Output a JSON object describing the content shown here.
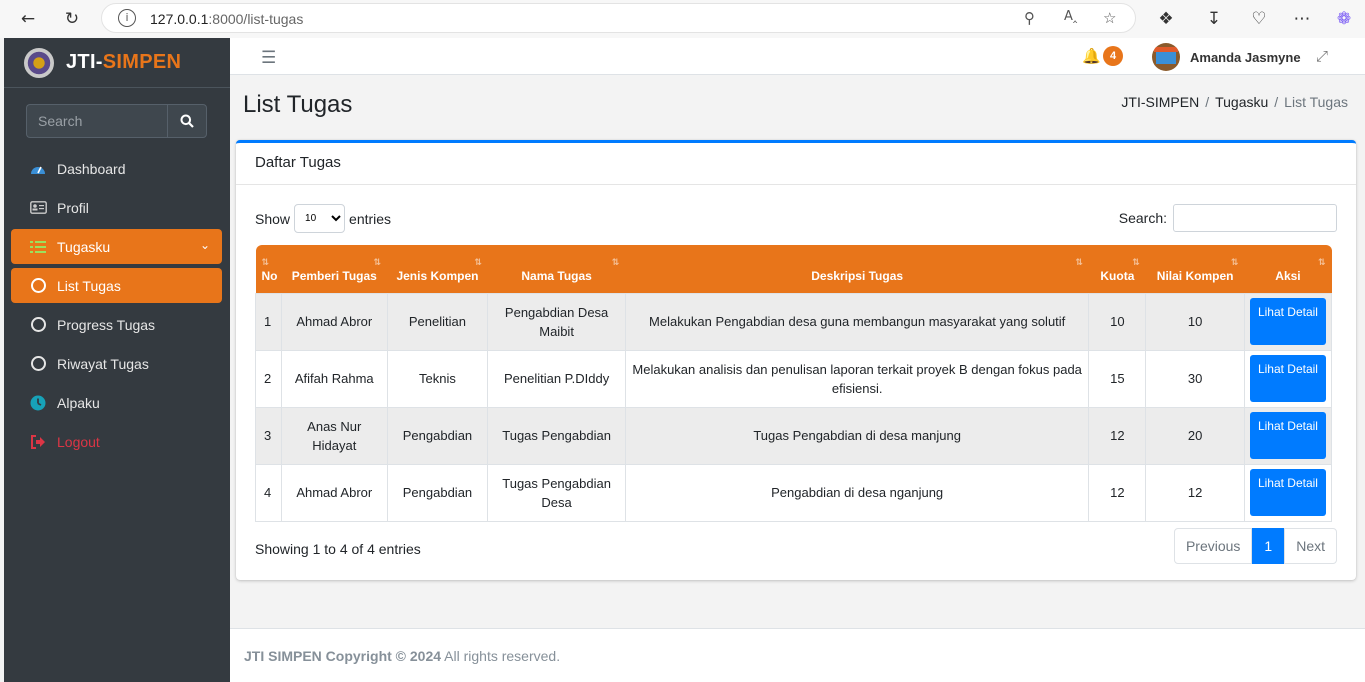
{
  "browser": {
    "url_host": "127.0.0.1",
    "url_path": ":8000/list-tugas"
  },
  "sidebar": {
    "brand_prefix": "JTI-",
    "brand_accent": "SIMPEN",
    "search_placeholder": "Search",
    "items": [
      {
        "label": "Dashboard",
        "icon": "dashboard-icon"
      },
      {
        "label": "Profil",
        "icon": "id-card-icon"
      },
      {
        "label": "Tugasku",
        "icon": "list-check-icon"
      },
      {
        "label": "List Tugas",
        "icon": "circle-icon"
      },
      {
        "label": "Progress Tugas",
        "icon": "circle-icon"
      },
      {
        "label": "Riwayat Tugas",
        "icon": "circle-icon"
      },
      {
        "label": "Alpaku",
        "icon": "clock-icon"
      },
      {
        "label": "Logout",
        "icon": "sign-out-icon"
      }
    ]
  },
  "topbar": {
    "notif_count": "4",
    "user_name": "Amanda Jasmyne"
  },
  "page": {
    "title": "List Tugas",
    "breadcrumb": [
      "JTI-SIMPEN",
      "Tugasku",
      "List Tugas"
    ]
  },
  "card": {
    "header": "Daftar Tugas",
    "show_label": "Show",
    "entries_label": "entries",
    "page_size": "10",
    "search_label": "Search:",
    "info": "Showing 1 to 4 of 4 entries",
    "pager": {
      "prev": "Previous",
      "current": "1",
      "next": "Next"
    }
  },
  "table": {
    "headers": [
      "No",
      "Pemberi Tugas",
      "Jenis Kompen",
      "Nama Tugas",
      "Deskripsi Tugas",
      "Kuota",
      "Nilai Kompen",
      "Aksi"
    ],
    "action_label": "Lihat Detail",
    "rows": [
      {
        "no": "1",
        "pemberi": "Ahmad Abror",
        "jenis": "Penelitian",
        "nama": "Pengabdian Desa Maibit",
        "deskripsi": "Melakukan Pengabdian desa guna membangun masyarakat yang solutif",
        "kuota": "10",
        "nilai": "10"
      },
      {
        "no": "2",
        "pemberi": "Afifah Rahma",
        "jenis": "Teknis",
        "nama": "Penelitian P.DIddy",
        "deskripsi": "Melakukan analisis dan penulisan laporan terkait proyek B dengan fokus pada efisiensi.",
        "kuota": "15",
        "nilai": "30"
      },
      {
        "no": "3",
        "pemberi": "Anas Nur Hidayat",
        "jenis": "Pengabdian",
        "nama": "Tugas Pengabdian",
        "deskripsi": "Tugas Pengabdian di desa manjung",
        "kuota": "12",
        "nilai": "20"
      },
      {
        "no": "4",
        "pemberi": "Ahmad Abror",
        "jenis": "Pengabdian",
        "nama": "Tugas Pengabdian Desa",
        "deskripsi": "Pengabdian di desa nganjung",
        "kuota": "12",
        "nilai": "12"
      }
    ]
  },
  "footer": {
    "bold": "JTI SIMPEN Copyright © 2024",
    "rest": " All rights reserved."
  },
  "colors": {
    "accent": "#e8751a",
    "primary": "#007bff",
    "sidebar": "#343a40",
    "logout": "#dc3545"
  }
}
